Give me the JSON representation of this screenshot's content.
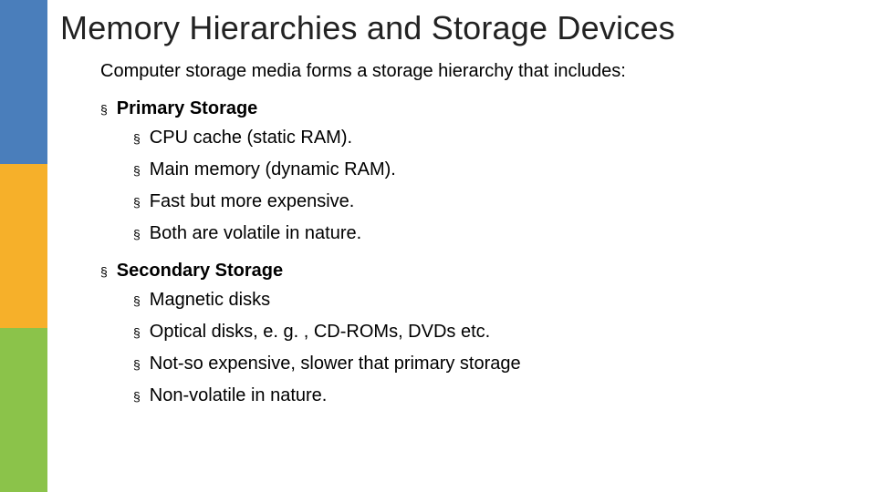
{
  "title": "Memory Hierarchies and Storage Devices",
  "subtitle": "Computer storage media forms a storage hierarchy that includes:",
  "sections": [
    {
      "heading": "Primary Storage",
      "items": [
        "CPU cache (static RAM).",
        "Main memory (dynamic RAM).",
        "Fast but more expensive.",
        "Both are volatile in nature."
      ]
    },
    {
      "heading": "Secondary Storage",
      "items": [
        "Magnetic disks",
        "Optical disks, e. g. , CD-ROMs, DVDs etc.",
        "Not-so expensive, slower that primary storage",
        " Non-volatile in nature."
      ]
    }
  ],
  "bullet_glyph": "§"
}
